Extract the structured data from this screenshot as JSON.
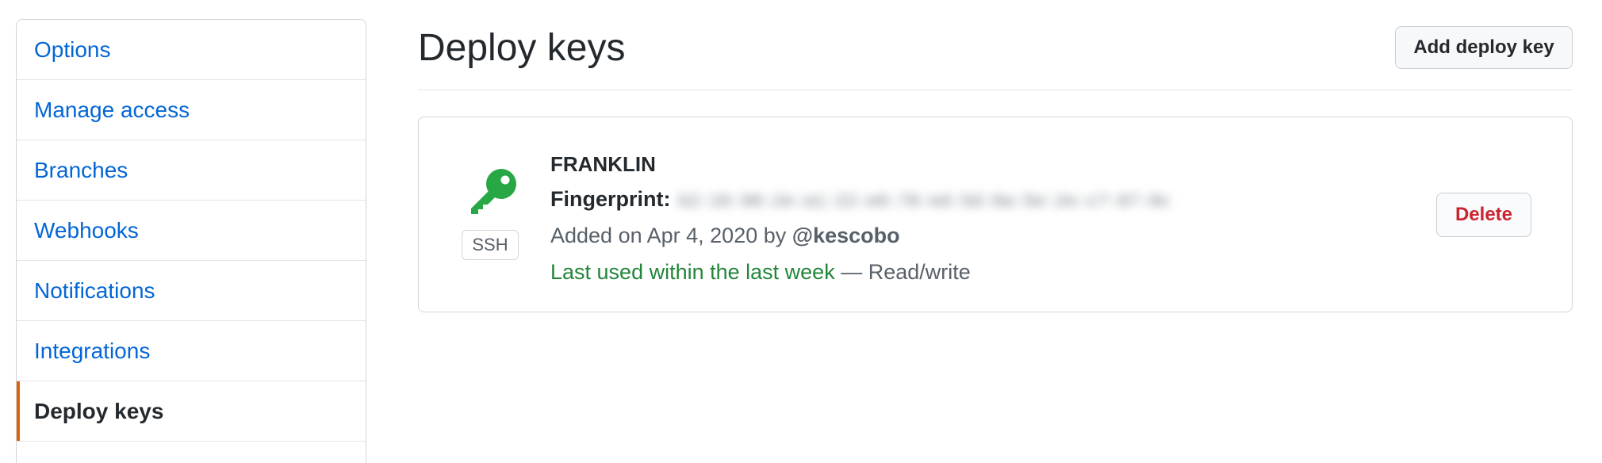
{
  "sidebar": {
    "items": [
      {
        "label": "Options"
      },
      {
        "label": "Manage access"
      },
      {
        "label": "Branches"
      },
      {
        "label": "Webhooks"
      },
      {
        "label": "Notifications"
      },
      {
        "label": "Integrations"
      },
      {
        "label": "Deploy keys",
        "selected": true
      }
    ]
  },
  "main": {
    "title": "Deploy keys",
    "add_button_label": "Add deploy key",
    "keys": [
      {
        "name": "FRANKLIN",
        "key_type_badge": "SSH",
        "fingerprint_label": "Fingerprint:",
        "fingerprint_value": "b2:16:98:2e:a1:22:e8:78:ed:5d:8a:5e:2e:c7:87:8c",
        "added_prefix": "Added on Apr 4, 2020 by",
        "added_user": "@kescobo",
        "last_used": "Last used within the last week",
        "access": "— Read/write",
        "delete_label": "Delete",
        "icon": "key-icon"
      }
    ]
  },
  "colors": {
    "link": "#0366d6",
    "selected_accent": "#e36209",
    "key_icon": "#28a745",
    "last_used_green": "#22863a",
    "danger": "#cb2431"
  }
}
